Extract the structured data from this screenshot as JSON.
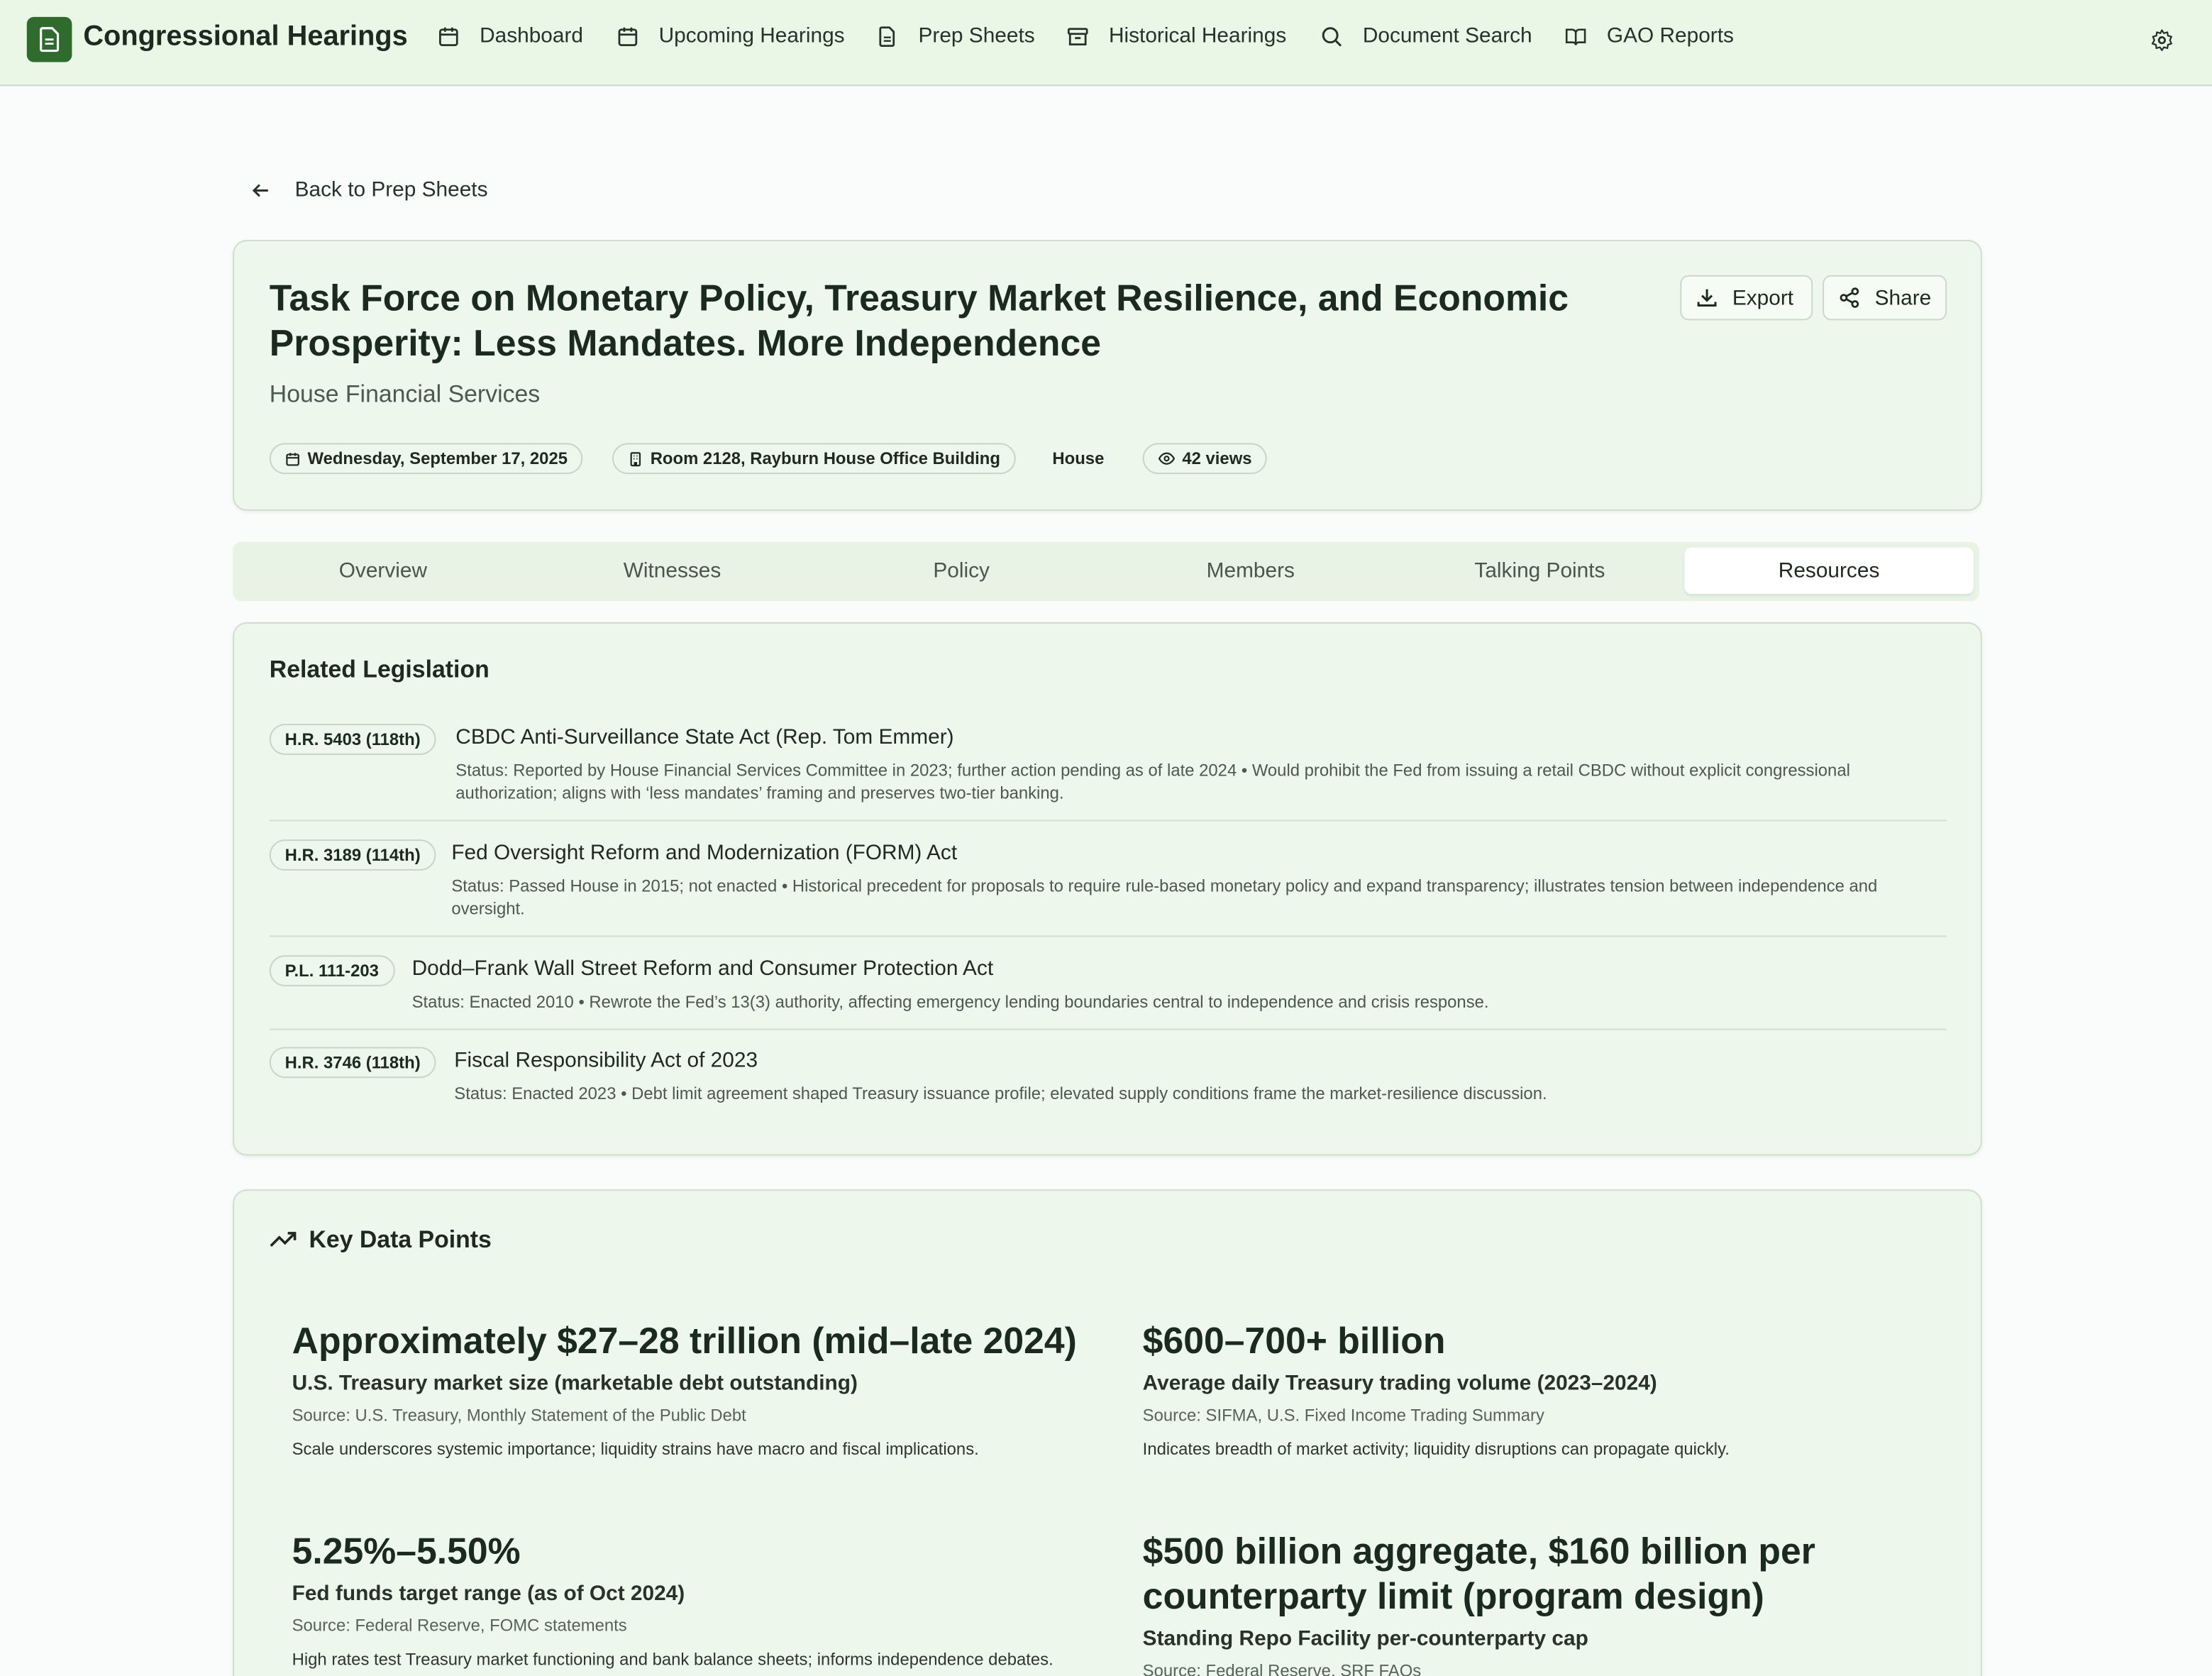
{
  "app": {
    "title": "Congressional Hearings"
  },
  "nav": {
    "items": [
      {
        "label": "Dashboard",
        "icon": "calendar-icon"
      },
      {
        "label": "Upcoming Hearings",
        "icon": "calendar-icon"
      },
      {
        "label": "Prep Sheets",
        "icon": "document-icon"
      },
      {
        "label": "Historical Hearings",
        "icon": "archive-icon"
      },
      {
        "label": "Document Search",
        "icon": "search-icon"
      },
      {
        "label": "GAO Reports",
        "icon": "book-icon"
      }
    ],
    "settings_icon": "gear-icon"
  },
  "back": {
    "label": "Back to Prep Sheets"
  },
  "hearing": {
    "title": "Task Force on Monetary Policy, Treasury Market Resilience, and Economic Prosperity: Less Mandates. More Independence",
    "committee": "House Financial Services",
    "date": "Wednesday, September 17, 2025",
    "location": "Room 2128, Rayburn House Office Building",
    "chamber": "House",
    "views": "42 views"
  },
  "actions": {
    "export": "Export",
    "share": "Share"
  },
  "tabs": [
    "Overview",
    "Witnesses",
    "Policy",
    "Members",
    "Talking Points",
    "Resources"
  ],
  "active_tab": "Resources",
  "legislation": {
    "heading": "Related Legislation",
    "items": [
      {
        "id": "H.R. 5403 (118th)",
        "title": "CBDC Anti-Surveillance State Act (Rep. Tom Emmer)",
        "status": "Status: Reported by House Financial Services Committee in 2023; further action pending as of late 2024 • Would prohibit the Fed from issuing a retail CBDC without explicit congressional authorization; aligns with ‘less mandates’ framing and preserves two-tier banking."
      },
      {
        "id": "H.R. 3189 (114th)",
        "title": "Fed Oversight Reform and Modernization (FORM) Act",
        "status": "Status: Passed House in 2015; not enacted • Historical precedent for proposals to require rule-based monetary policy and expand transparency; illustrates tension between independence and oversight."
      },
      {
        "id": "P.L. 111-203",
        "title": "Dodd–Frank Wall Street Reform and Consumer Protection Act",
        "status": "Status: Enacted 2010 • Rewrote the Fed’s 13(3) authority, affecting emergency lending boundaries central to independence and crisis response."
      },
      {
        "id": "H.R. 3746 (118th)",
        "title": "Fiscal Responsibility Act of 2023",
        "status": "Status: Enacted 2023 • Debt limit agreement shaped Treasury issuance profile; elevated supply conditions frame the market-resilience discussion."
      }
    ]
  },
  "key_data": {
    "heading": "Key Data Points",
    "items": [
      {
        "value": "Approximately $27–28 trillion (mid–late 2024)",
        "label": "U.S. Treasury market size (marketable debt outstanding)",
        "source": "Source: U.S. Treasury, Monthly Statement of the Public Debt",
        "note": "Scale underscores systemic importance; liquidity strains have macro and fiscal implications."
      },
      {
        "value": "$600–700+ billion",
        "label": "Average daily Treasury trading volume (2023–2024)",
        "source": "Source: SIFMA, U.S. Fixed Income Trading Summary",
        "note": "Indicates breadth of market activity; liquidity disruptions can propagate quickly."
      },
      {
        "value": "5.25%–5.50%",
        "label": "Fed funds target range (as of Oct 2024)",
        "source": "Source: Federal Reserve, FOMC statements",
        "note": "High rates test Treasury market functioning and bank balance sheets; informs independence debates."
      },
      {
        "value": "$500 billion aggregate, $160 billion per counterparty limit (program design)",
        "label": "Standing Repo Facility per-counterparty cap",
        "source": "Source: Federal Reserve, SRF FAQs",
        "note": ""
      }
    ]
  }
}
